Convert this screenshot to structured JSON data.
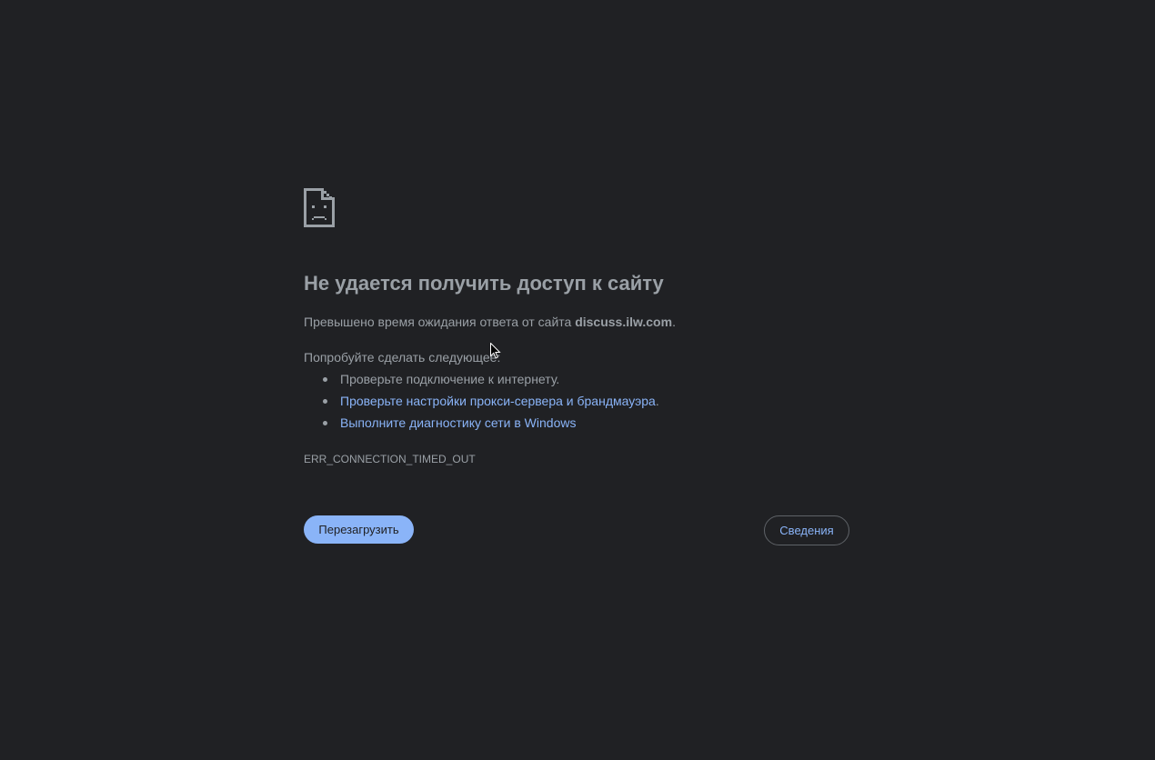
{
  "error_page": {
    "icon": "sad-page-icon",
    "title": "Не удается получить доступ к сайту",
    "summary_prefix": "Превышено время ожидания ответа от сайта ",
    "summary_host": "discuss.ilw.com",
    "summary_suffix": ".",
    "suggestions_heading": "Попробуйте сделать следующее:",
    "suggestions": [
      {
        "text": "Проверьте подключение к интернету.",
        "suffix": ""
      },
      {
        "text": "Проверьте настройки прокси-сервера и брандмауэра",
        "suffix": "."
      },
      {
        "text": "Выполните диагностику сети в Windows",
        "suffix": ""
      }
    ],
    "error_code": "ERR_CONNECTION_TIMED_OUT",
    "reload_label": "Перезагрузить",
    "details_label": "Сведения"
  },
  "colors": {
    "background": "#202124",
    "text": "#9aa0a6",
    "link": "#8ab4f8",
    "primary_button": "#8ab4f8",
    "border": "#5f6368"
  }
}
